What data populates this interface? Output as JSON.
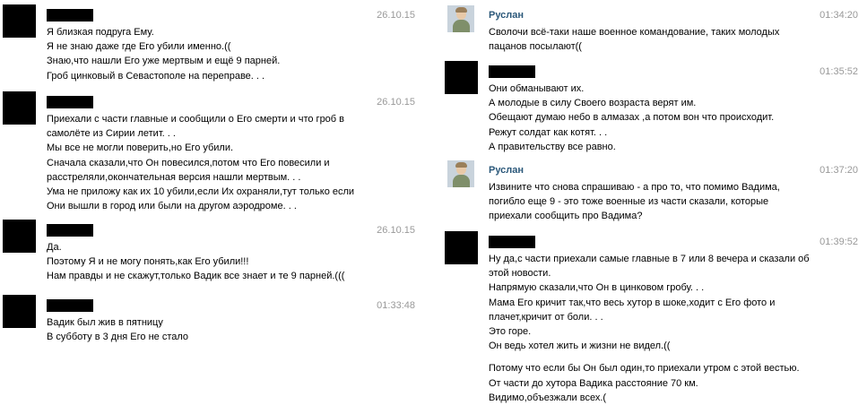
{
  "left_messages": [
    {
      "timestamp": "26.10.15",
      "lines": [
        "Я близкая подруга Ему.",
        "Я не знаю даже где Его убили именно.((",
        "Знаю,что нашли Его уже мертвым и ещё 9 парней.",
        "Гроб цинковый в Севастополе на переправе. . ."
      ]
    },
    {
      "timestamp": "26.10.15",
      "lines": [
        "Приехали с части главные и сообщили о Его смерти и что гроб в",
        "самолёте из Сирии летит. . .",
        "Мы все не могли поверить,но Его убили.",
        "Сначала сказали,что Он повесился,потом что Его повесили и",
        "расстреляли,окончательная версия нашли мертвым. . .",
        "Ума не приложу как их 10 убили,если Их охраняли,тут только если",
        "Они вышли в город или были на другом аэродроме. . ."
      ]
    },
    {
      "timestamp": "26.10.15",
      "lines": [
        "Да.",
        "Поэтому Я и не могу понять,как Его убили!!!",
        "Нам правды и не скажут,только Вадик все знает и те 9 парней.((("
      ]
    },
    {
      "timestamp": "01:33:48",
      "lines": [
        "Вадик был жив в пятницу",
        "В субботу в 3 дня Его не стало"
      ]
    }
  ],
  "right_messages": [
    {
      "author": "Руслан",
      "timestamp": "01:34:20",
      "lines": [
        "Сволочи всё-таки наше военное командование, таких молодых",
        "пацанов посылают(("
      ]
    },
    {
      "author": "",
      "timestamp": "01:35:52",
      "lines": [
        "Они обманывают их.",
        "А молодые в силу Своего возраста верят им.",
        "Обещают думаю небо в алмазах ,а потом вон что происходит.",
        "Режут солдат как котят. . .",
        "А правительству все равно."
      ]
    },
    {
      "author": "Руслан",
      "timestamp": "01:37:20",
      "lines": [
        "Извините что снова спрашиваю - а про то, что помимо Вадима,",
        "погибло еще 9 - это тоже военные из части сказали, которые",
        "приехали сообщить про Вадима?"
      ]
    },
    {
      "author": "",
      "timestamp": "01:39:52",
      "lines": [
        "Ну да,с части приехали самые главные в 7 или 8 вечера и сказали об",
        "этой новости.",
        "Напрямую сказали,что Он в цинковом гробу. . .",
        "Мама Его кричит так,что весь хутор в шоке,ходит с Его фото и",
        "плачет,кричит от боли. . .",
        "Это горе.",
        "Он ведь хотел жить и жизни не видел.(("
      ],
      "continuation": [
        "Потому что если бы Он был один,то приехали утром с этой вестью.",
        "От части до хутора Вадика расстояние 70 км.",
        "Видимо,объезжали всех.("
      ]
    }
  ]
}
